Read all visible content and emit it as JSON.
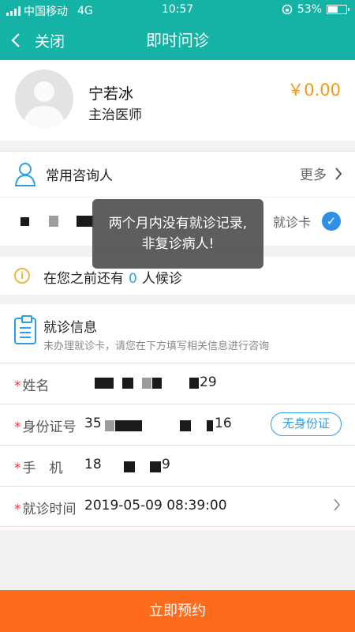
{
  "status": {
    "carrier": "中国移动",
    "network": "4G",
    "time": "10:57",
    "battery": "53%",
    "battery_level": 0.53
  },
  "nav": {
    "back_label": "关闭",
    "title": "即时问诊"
  },
  "doctor": {
    "name": "宁若冰",
    "title": "主治医师",
    "price": "￥0.00"
  },
  "consultants": {
    "title": "常用咨询人",
    "more_label": "更多",
    "card_label": "就诊卡"
  },
  "toast": {
    "message": "两个月内没有就诊记录,非复诊病人!"
  },
  "queue": {
    "prefix": "在您之前还有",
    "count": "0",
    "suffix": "人候诊"
  },
  "visit_form": {
    "title": "就诊信息",
    "subtitle": "未办理就诊卡，请您在下方填写相关信息进行咨询",
    "name": {
      "label": "姓名",
      "value_suffix": "29"
    },
    "id_number": {
      "label": "身份证号",
      "value_prefix": "35",
      "value_suffix": "16",
      "no_id_button": "无身份证"
    },
    "phone": {
      "label": "手　机",
      "value_prefix": "18",
      "value_suffix": "9"
    },
    "visit_time": {
      "label": "就诊时间",
      "value": "2019-05-09 08:39:00"
    },
    "required_mark": "*"
  },
  "submit_button": "立即预约",
  "colors": {
    "header": "#14b3a5",
    "price": "#f39a1e",
    "accent_blue": "#2f9ee3",
    "submit": "#ff6b1c",
    "required": "#e34040"
  }
}
